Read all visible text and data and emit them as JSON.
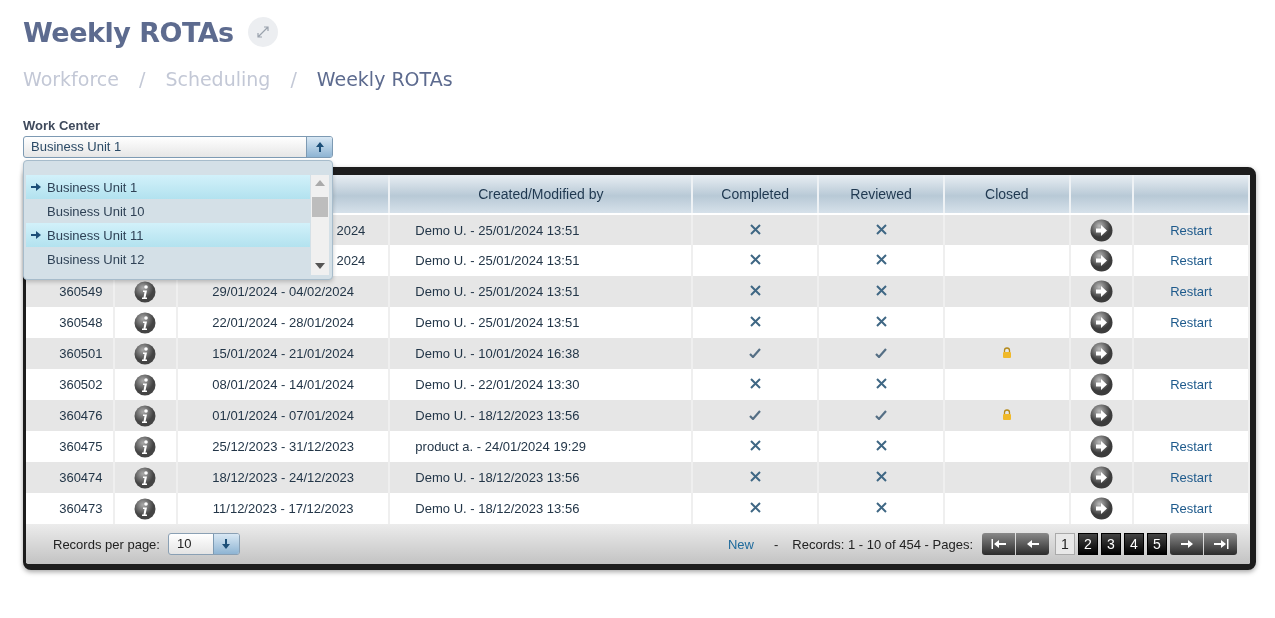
{
  "page": {
    "title": "Weekly ROTAs"
  },
  "breadcrumb": [
    {
      "label": "Workforce",
      "current": false
    },
    {
      "label": "Scheduling",
      "current": false
    },
    {
      "label": "Weekly ROTAs",
      "current": true
    }
  ],
  "breadcrumb_separators": [
    "/",
    "/"
  ],
  "work_center": {
    "label": "Work Center",
    "value": "Business Unit 1",
    "expanded": true,
    "options": [
      {
        "label": "Business Unit 1",
        "selected": true
      },
      {
        "label": "Business Unit 10",
        "selected": false
      },
      {
        "label": "Business Unit 11",
        "selected": true
      },
      {
        "label": "Business Unit 12",
        "selected": false
      }
    ]
  },
  "table": {
    "columns": [
      "Created/Modified by",
      "Completed",
      "Reviewed",
      "Closed"
    ],
    "rows": [
      {
        "covered": true,
        "dates": "2024",
        "modified": "Demo U. - 25/01/2024 13:51",
        "completed": false,
        "reviewed": false,
        "closed": false,
        "action": "Restart"
      },
      {
        "covered": true,
        "dates": "2024",
        "modified": "Demo U. - 25/01/2024 13:51",
        "completed": false,
        "reviewed": false,
        "closed": false,
        "action": "Restart"
      },
      {
        "covered": false,
        "id": "360549",
        "dates": "29/01/2024 - 04/02/2024",
        "modified": "Demo U. - 25/01/2024 13:51",
        "completed": false,
        "reviewed": false,
        "closed": false,
        "action": "Restart"
      },
      {
        "covered": false,
        "id": "360548",
        "dates": "22/01/2024 - 28/01/2024",
        "modified": "Demo U. - 25/01/2024 13:51",
        "completed": false,
        "reviewed": false,
        "closed": false,
        "action": "Restart"
      },
      {
        "covered": false,
        "id": "360501",
        "dates": "15/01/2024 - 21/01/2024",
        "modified": "Demo U. - 10/01/2024 16:38",
        "completed": true,
        "reviewed": true,
        "closed": true
      },
      {
        "covered": false,
        "id": "360502",
        "dates": "08/01/2024 - 14/01/2024",
        "modified": "Demo U. - 22/01/2024 13:30",
        "completed": false,
        "reviewed": false,
        "closed": false,
        "action": "Restart"
      },
      {
        "covered": false,
        "id": "360476",
        "dates": "01/01/2024 - 07/01/2024",
        "modified": "Demo U. - 18/12/2023 13:56",
        "completed": true,
        "reviewed": true,
        "closed": true
      },
      {
        "covered": false,
        "id": "360475",
        "dates": "25/12/2023 - 31/12/2023",
        "modified": "product a. - 24/01/2024 19:29",
        "completed": false,
        "reviewed": false,
        "closed": false,
        "action": "Restart"
      },
      {
        "covered": false,
        "id": "360474",
        "dates": "18/12/2023 - 24/12/2023",
        "modified": "Demo U. - 18/12/2023 13:56",
        "completed": false,
        "reviewed": false,
        "closed": false,
        "action": "Restart"
      },
      {
        "covered": false,
        "id": "360473",
        "dates": "11/12/2023 - 17/12/2023",
        "modified": "Demo U. - 18/12/2023 13:56",
        "completed": false,
        "reviewed": false,
        "closed": false,
        "action": "Restart"
      }
    ]
  },
  "footer": {
    "records_per_page_label": "Records per page:",
    "records_per_page": "10",
    "new_link": "New",
    "separator": "-",
    "records_info": "Records: 1 - 10 of 454 - Pages:",
    "pages": [
      {
        "label": "1",
        "selected": true
      },
      {
        "label": "2",
        "selected": false
      },
      {
        "label": "3",
        "selected": false
      },
      {
        "label": "4",
        "selected": false
      },
      {
        "label": "5",
        "selected": false
      }
    ]
  }
}
